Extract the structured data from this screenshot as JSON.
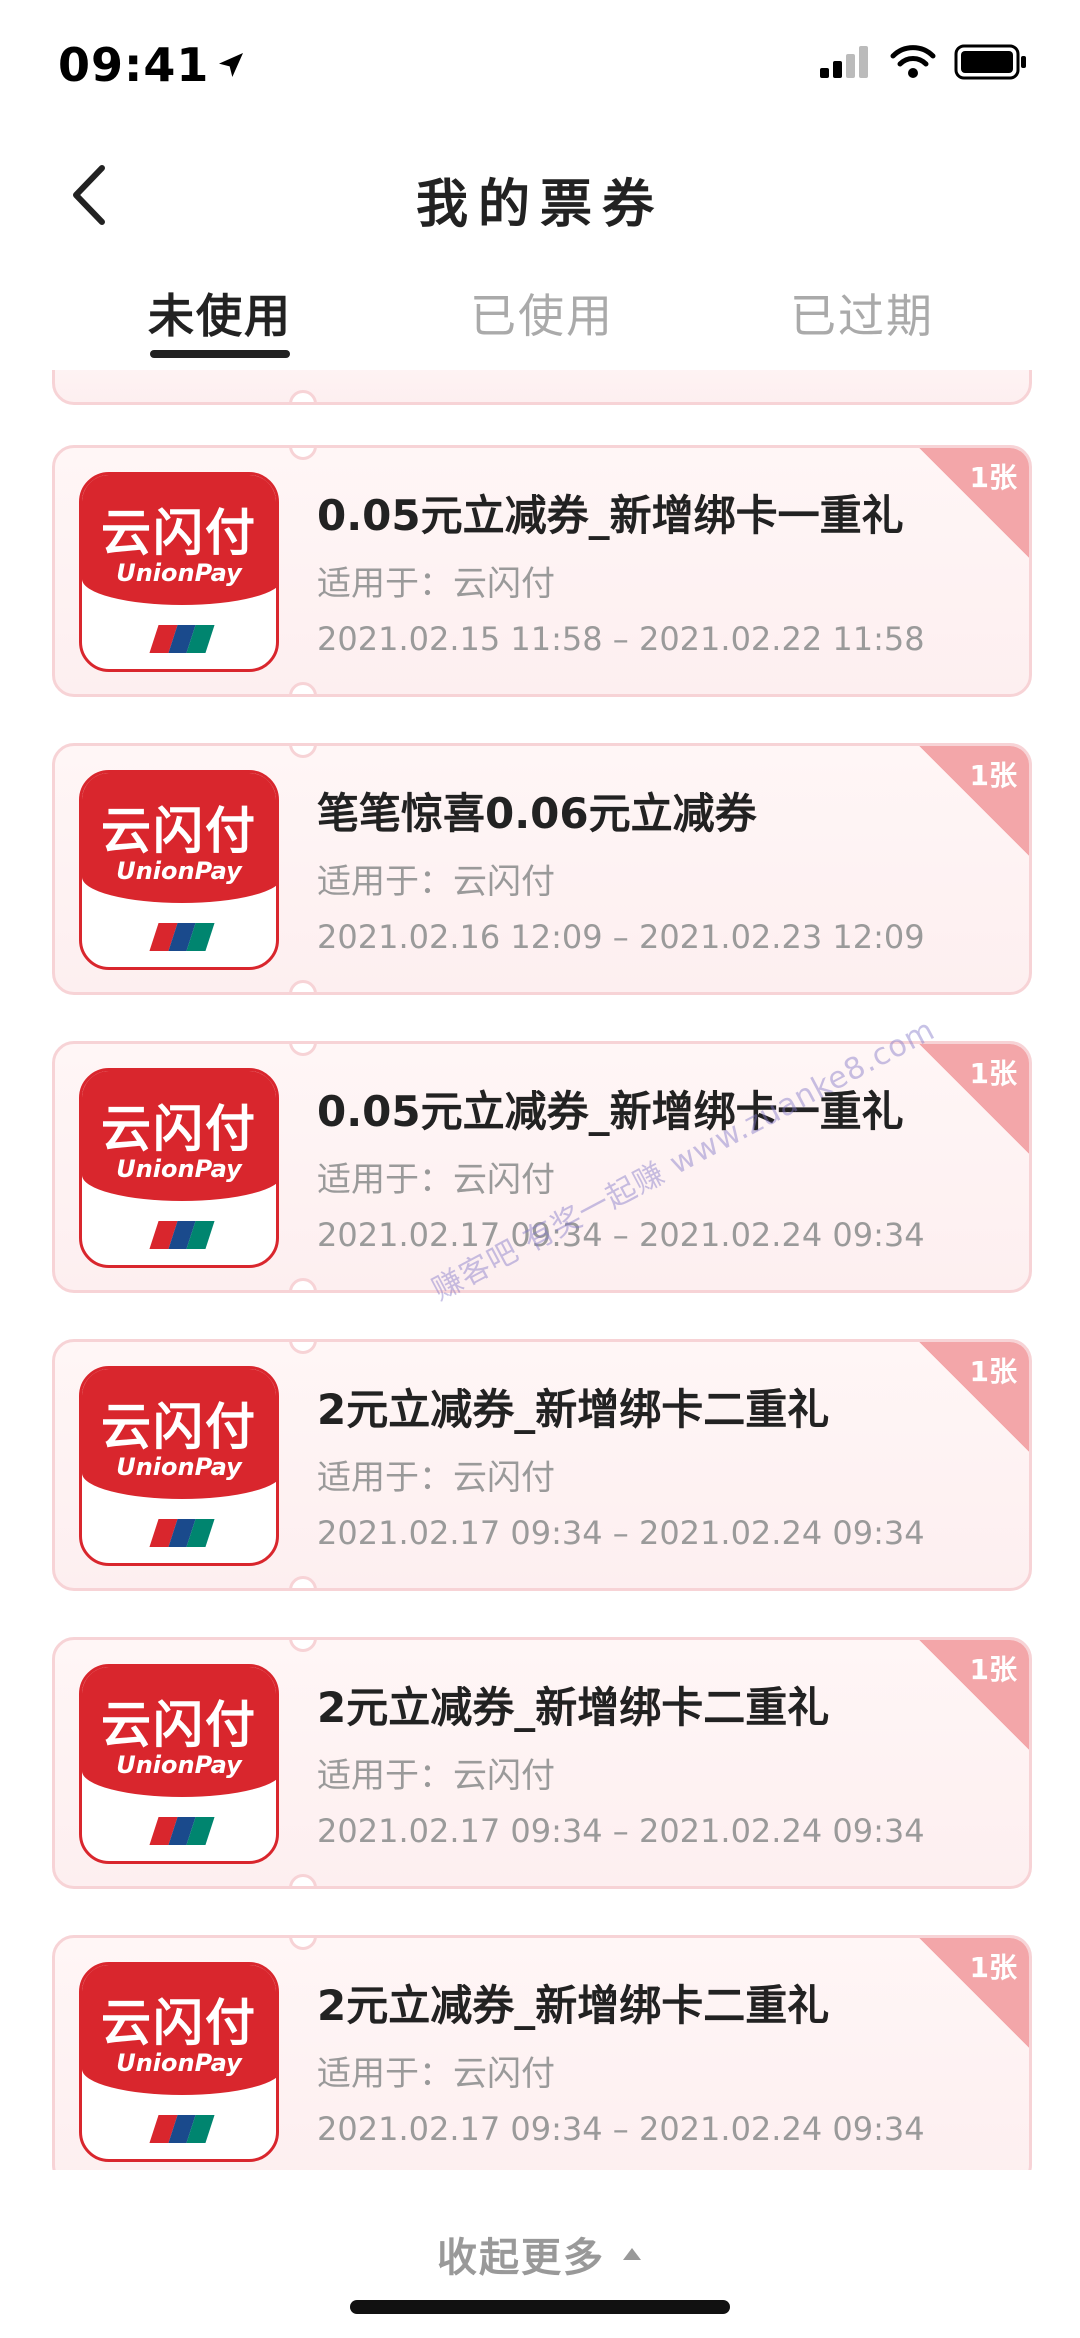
{
  "status_bar": {
    "time": "09:41"
  },
  "header": {
    "title": "我的票券"
  },
  "tabs": [
    {
      "label": "未使用",
      "active": true
    },
    {
      "label": "已使用",
      "active": false
    },
    {
      "label": "已过期",
      "active": false
    }
  ],
  "logo": {
    "cn": "云闪付",
    "en": "UnionPay",
    "flag_colors": [
      "#d9262d",
      "#1a4a8c",
      "#00856f"
    ]
  },
  "coupons": [
    {
      "title": "0.05元立减券_新增绑卡一重礼",
      "applies_to": "适用于：云闪付",
      "dates": "2021.02.15 11:58 – 2021.02.22 11:58",
      "badge": "1张"
    },
    {
      "title": "笔笔惊喜0.06元立减券",
      "applies_to": "适用于：云闪付",
      "dates": "2021.02.16 12:09 – 2021.02.23 12:09",
      "badge": "1张"
    },
    {
      "title": "0.05元立减券_新增绑卡一重礼",
      "applies_to": "适用于：云闪付",
      "dates": "2021.02.17 09:34 – 2021.02.24 09:34",
      "badge": "1张"
    },
    {
      "title": "2元立减券_新增绑卡二重礼",
      "applies_to": "适用于：云闪付",
      "dates": "2021.02.17 09:34 – 2021.02.24 09:34",
      "badge": "1张"
    },
    {
      "title": "2元立减券_新增绑卡二重礼",
      "applies_to": "适用于：云闪付",
      "dates": "2021.02.17 09:34 – 2021.02.24 09:34",
      "badge": "1张"
    },
    {
      "title": "2元立减券_新增绑卡二重礼",
      "applies_to": "适用于：云闪付",
      "dates": "2021.02.17 09:34 – 2021.02.24 09:34",
      "badge": "1张"
    }
  ],
  "watermark": "赚客吧 有奖一起赚 www.zuanke8.com",
  "collapse_label": "收起更多",
  "colors": {
    "brand_red": "#d9262d",
    "card_bg": "#fdeff0",
    "card_border": "#f7d3d6",
    "badge": "#f3a6a9"
  }
}
